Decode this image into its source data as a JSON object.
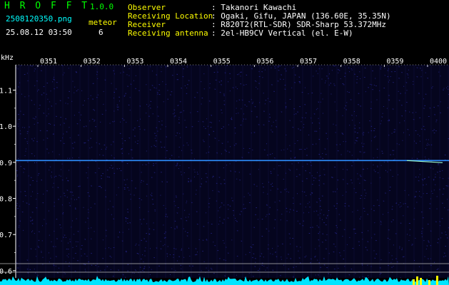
{
  "app": {
    "name": "H R O F F T",
    "version": "1.0.0"
  },
  "header": {
    "filename": "2508120350.png",
    "datetime": "25.08.12 03:50",
    "meteor_label": "meteor",
    "meteor_count": "6"
  },
  "station": {
    "labels": [
      "Observer",
      "Receiving Location",
      "Receiver",
      "Receiving antenna"
    ],
    "values": [
      ": Takanori Kawachi",
      ": Ogaki, Gifu, JAPAN (136.60E, 35.35N)",
      ": R820T2(RTL-SDR) SDR-Sharp 53.372MHz",
      ": 2el-HB9CV Vertical (el. E-W)"
    ]
  },
  "chart_data": {
    "type": "heatmap",
    "ylabel": "kHz",
    "x_ticks": [
      "0351",
      "0352",
      "0353",
      "0354",
      "0355",
      "0356",
      "0357",
      "0358",
      "0359",
      "0400"
    ],
    "y_ticks": [
      1.1,
      1.0,
      0.9,
      0.8,
      0.7,
      0.6
    ],
    "ylim": [
      0.58,
      1.17
    ],
    "signal_line_khz": 0.905,
    "colors": {
      "background": "#05051e",
      "noise": "#2a2a9a",
      "signal": "#2e90ff",
      "tick_text": "#ffffff",
      "axis": "#ffffff",
      "power_trace": "#00e5ff",
      "power_peak": "#ffff00"
    }
  }
}
